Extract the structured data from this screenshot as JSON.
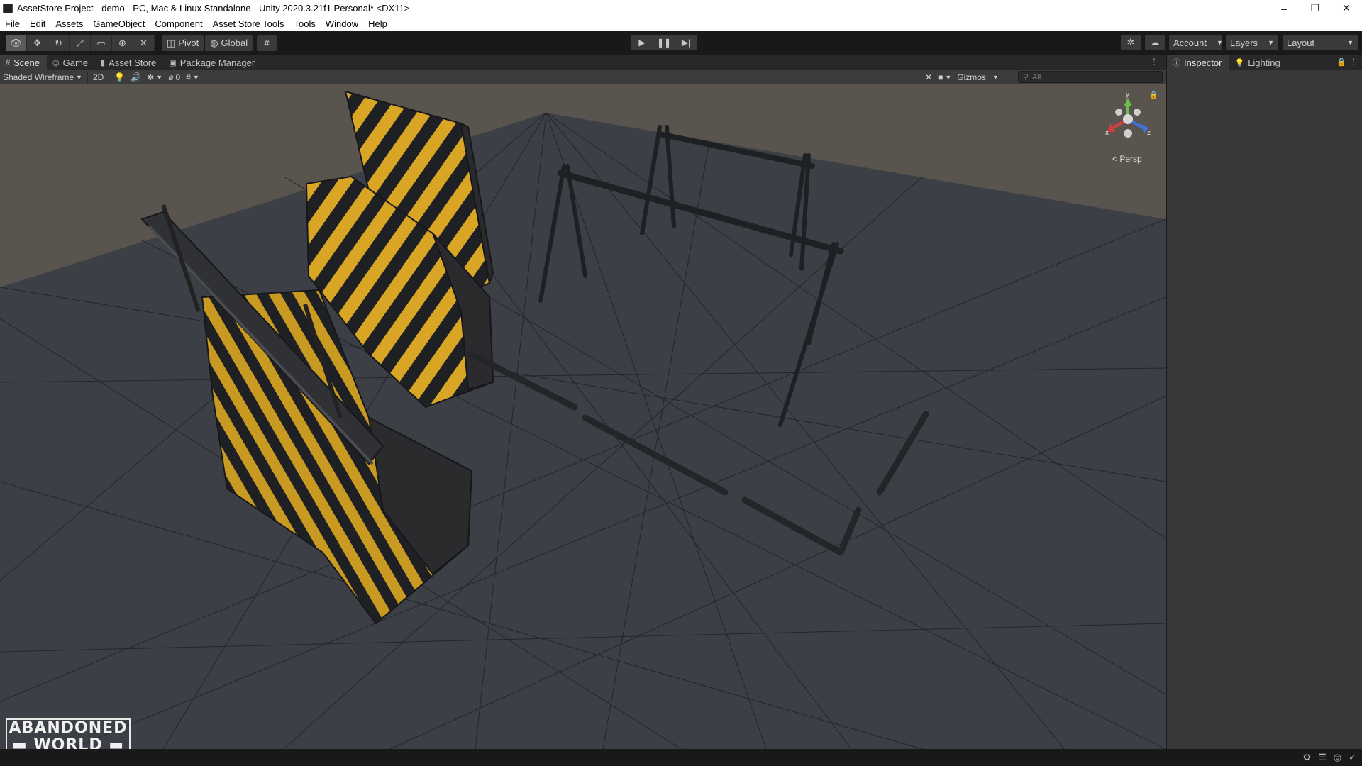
{
  "window": {
    "title": "AssetStore Project - demo - PC, Mac & Linux Standalone - Unity 2020.3.21f1 Personal* <DX11>",
    "controls": {
      "minimize": "–",
      "maximize": "❐",
      "close": "✕"
    }
  },
  "menu": [
    "File",
    "Edit",
    "Assets",
    "GameObject",
    "Component",
    "Asset Store Tools",
    "Tools",
    "Window",
    "Help"
  ],
  "toolbar": {
    "transform_tools": [
      {
        "icon": "view-tool-icon",
        "glyph": "👁"
      },
      {
        "icon": "move-tool-icon",
        "glyph": "✥"
      },
      {
        "icon": "rotate-tool-icon",
        "glyph": "↻"
      },
      {
        "icon": "scale-tool-icon",
        "glyph": "⤢"
      },
      {
        "icon": "rect-tool-icon",
        "glyph": "▭"
      },
      {
        "icon": "transform-tool-icon",
        "glyph": "⊕"
      },
      {
        "icon": "custom-tool-icon",
        "glyph": "✕"
      }
    ],
    "pivot_label": "Pivot",
    "global_label": "Global",
    "snap_glyph": "#",
    "play_glyph": "▶",
    "pause_glyph": "❚❚",
    "step_glyph": "▶|",
    "collab_glyph": "✲",
    "cloud_glyph": "☁",
    "account_label": "Account",
    "layers_label": "Layers",
    "layout_label": "Layout"
  },
  "scene_tabs": [
    {
      "label": "Scene",
      "icon": "#"
    },
    {
      "label": "Game",
      "icon": "◎"
    },
    {
      "label": "Asset Store",
      "icon": "▮"
    },
    {
      "label": "Package Manager",
      "icon": "▣"
    }
  ],
  "scene_bar": {
    "draw_mode": "Shaded Wireframe",
    "mode_2d": "2D",
    "light_glyph": "💡",
    "audio_glyph": "🔊",
    "fx_glyph": "✲",
    "hidden_count": "0",
    "grid_glyph": "#",
    "tools_glyph": "✕",
    "camera_glyph": "■",
    "gizmos_label": "Gizmos",
    "search_placeholder": "All"
  },
  "viewport": {
    "gizmo_axes": {
      "y": "y",
      "x": "x",
      "z": "z"
    },
    "projection_label": "< Persp",
    "logo_line1": "ABANDONED",
    "logo_line2": "WORLD",
    "colors": {
      "sky": "#5a544e",
      "ground": "#3c4046",
      "stripe_yellow": "#d9a524",
      "stripe_black": "#1f2024",
      "wire": "#1c1f22"
    }
  },
  "inspector": {
    "tabs": [
      {
        "label": "Inspector",
        "icon": "ⓘ"
      },
      {
        "label": "Lighting",
        "icon": "💡"
      }
    ]
  },
  "status_icons": [
    "⚙",
    "☰",
    "◎",
    "✓"
  ]
}
